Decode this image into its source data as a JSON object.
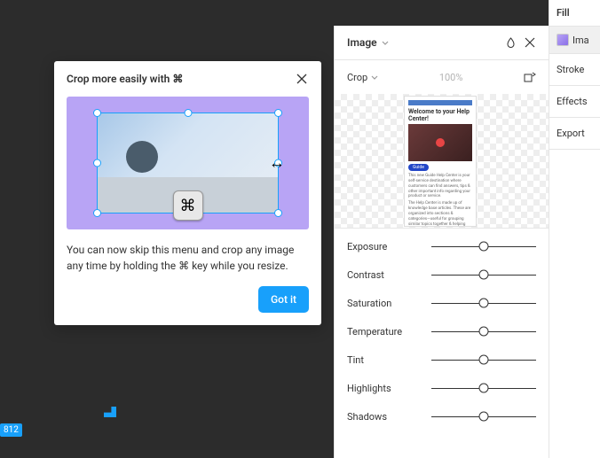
{
  "tip": {
    "title": "Crop more easily with ⌘",
    "body": "You can now skip this menu and crop any image any time by holding the ⌘ key while you resize.",
    "cmd_glyph": "⌘",
    "button": "Got it"
  },
  "panel": {
    "title": "Image",
    "crop_label": "Crop",
    "crop_value": "100%",
    "thumb": {
      "heading": "Welcome to your Help Center!",
      "pill": "Guide",
      "text1": "This new Guide Help Center is your self-service destination where customers can find answers, tips & other important info regarding your product or service.",
      "text2": "The Help Center is made up of knowledge base articles. These are organized into sections & categories—useful for grouping similar topics together & helping your customers find what they're looking for."
    },
    "sliders": [
      {
        "label": "Exposure",
        "pos": 50
      },
      {
        "label": "Contrast",
        "pos": 50
      },
      {
        "label": "Saturation",
        "pos": 50
      },
      {
        "label": "Temperature",
        "pos": 50
      },
      {
        "label": "Tint",
        "pos": 50
      },
      {
        "label": "Highlights",
        "pos": 50
      },
      {
        "label": "Shadows",
        "pos": 50
      }
    ]
  },
  "right": {
    "fill": "Fill",
    "image": "Ima",
    "stroke": "Stroke",
    "effects": "Effects",
    "export": "Export"
  },
  "badge": "812"
}
